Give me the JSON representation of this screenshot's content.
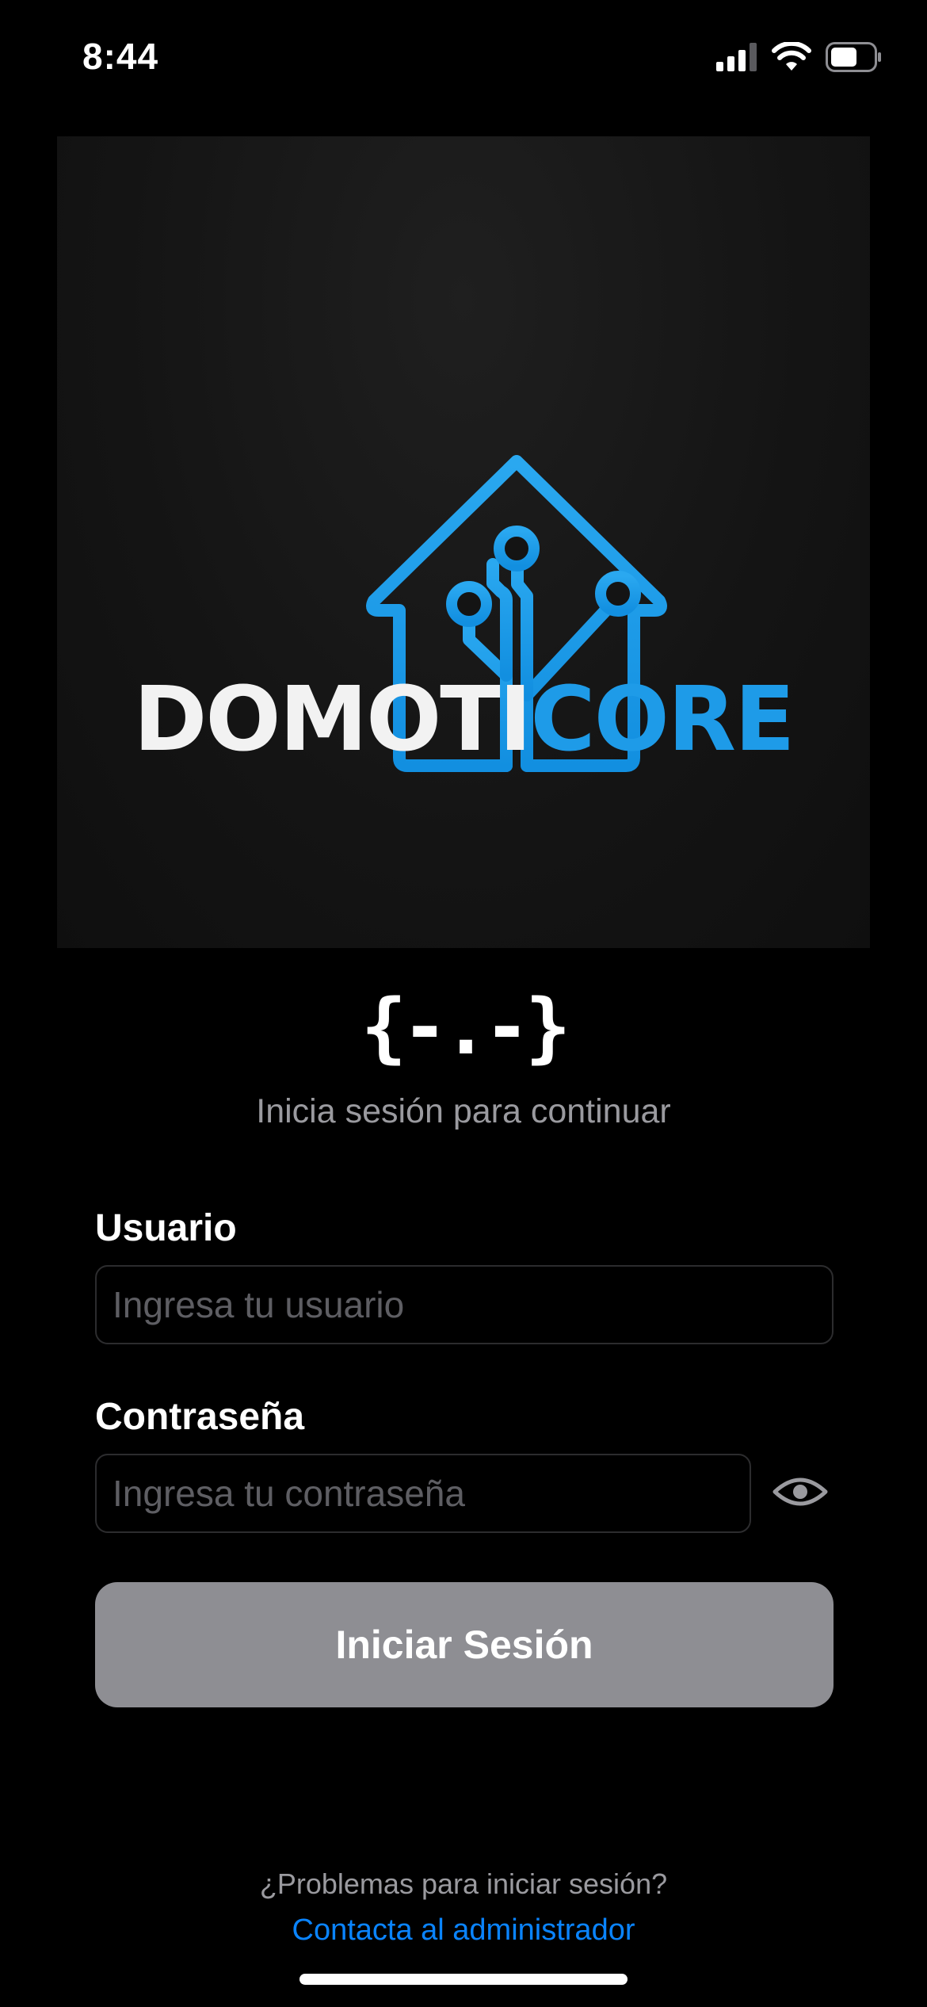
{
  "status_bar": {
    "time": "8:44",
    "icons": [
      "cellular-signal-icon",
      "wifi-icon",
      "battery-icon"
    ]
  },
  "logo": {
    "icon": "smart-house-circuit-icon",
    "wordmark_part1": "DOMOTI",
    "wordmark_part2": "CORE",
    "accent_color": "#1e9be8"
  },
  "brand_glyph": "{-.-}",
  "subtitle": "Inicia sesión para continuar",
  "form": {
    "username": {
      "label": "Usuario",
      "placeholder": "Ingresa tu usuario",
      "value": ""
    },
    "password": {
      "label": "Contraseña",
      "placeholder": "Ingresa tu contraseña",
      "value": "",
      "toggle_icon": "eye-icon"
    },
    "submit_label": "Iniciar Sesión"
  },
  "help": {
    "question": "¿Problemas para iniciar sesión?",
    "link": "Contacta al administrador",
    "link_color": "#0a84ff"
  },
  "colors": {
    "background": "#000000",
    "button_disabled": "#8e8e93",
    "secondary_text": "#9a9a9f"
  }
}
